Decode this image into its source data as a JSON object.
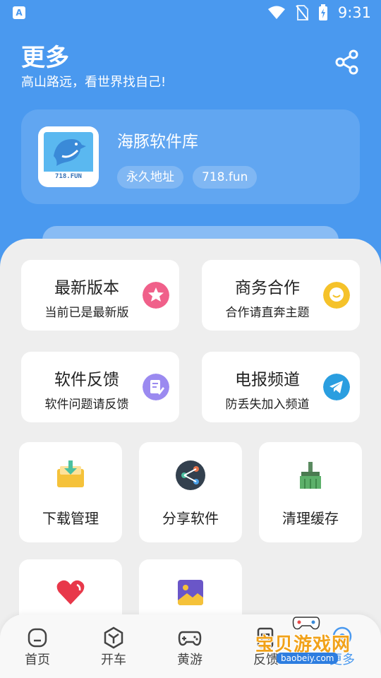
{
  "status_bar": {
    "time": "9:31",
    "app_glyph": "A"
  },
  "header": {
    "title": "更多",
    "subtitle": "高山路远，看世界找自己!",
    "share_icon": "share-icon"
  },
  "app_card": {
    "name": "海豚软件库",
    "logo_text": "718.FUN",
    "chips": [
      "永久地址",
      "718.fun"
    ]
  },
  "wide_cards": [
    {
      "title": "最新版本",
      "subtitle": "当前已是最新版",
      "icon": "star-icon",
      "color": "#f0608a"
    },
    {
      "title": "商务合作",
      "subtitle": "合作请直奔主题",
      "icon": "chat-bubble-icon",
      "color": "#f5c22a"
    },
    {
      "title": "软件反馈",
      "subtitle": "软件问题请反馈",
      "icon": "feedback-doc-icon",
      "color": "#9b8af0"
    },
    {
      "title": "电报频道",
      "subtitle": "防丢失加入频道",
      "icon": "telegram-icon",
      "color": "#2a9ee0"
    }
  ],
  "square_cards": [
    {
      "label": "下载管理",
      "icon": "download-folder-icon"
    },
    {
      "label": "分享软件",
      "icon": "share-circle-icon"
    },
    {
      "label": "清理缓存",
      "icon": "broom-icon"
    },
    {
      "label": "",
      "icon": "heart-icon"
    },
    {
      "label": "",
      "icon": "image-icon"
    }
  ],
  "tabbar": {
    "tabs": [
      {
        "label": "首页",
        "icon": "home-icon",
        "active": false
      },
      {
        "label": "开车",
        "icon": "cube-icon",
        "active": false
      },
      {
        "label": "黄游",
        "icon": "gamepad-icon",
        "active": false
      },
      {
        "label": "反馈",
        "icon": "feedback-icon",
        "active": false
      },
      {
        "label": "更多",
        "icon": "more-icon",
        "active": true
      }
    ]
  },
  "watermark": {
    "title": "宝贝游戏网",
    "url": "baobeiy.com"
  },
  "colors": {
    "primary": "#4a99ef",
    "sheet_bg": "#eeeeee",
    "card_bg": "#ffffff"
  }
}
